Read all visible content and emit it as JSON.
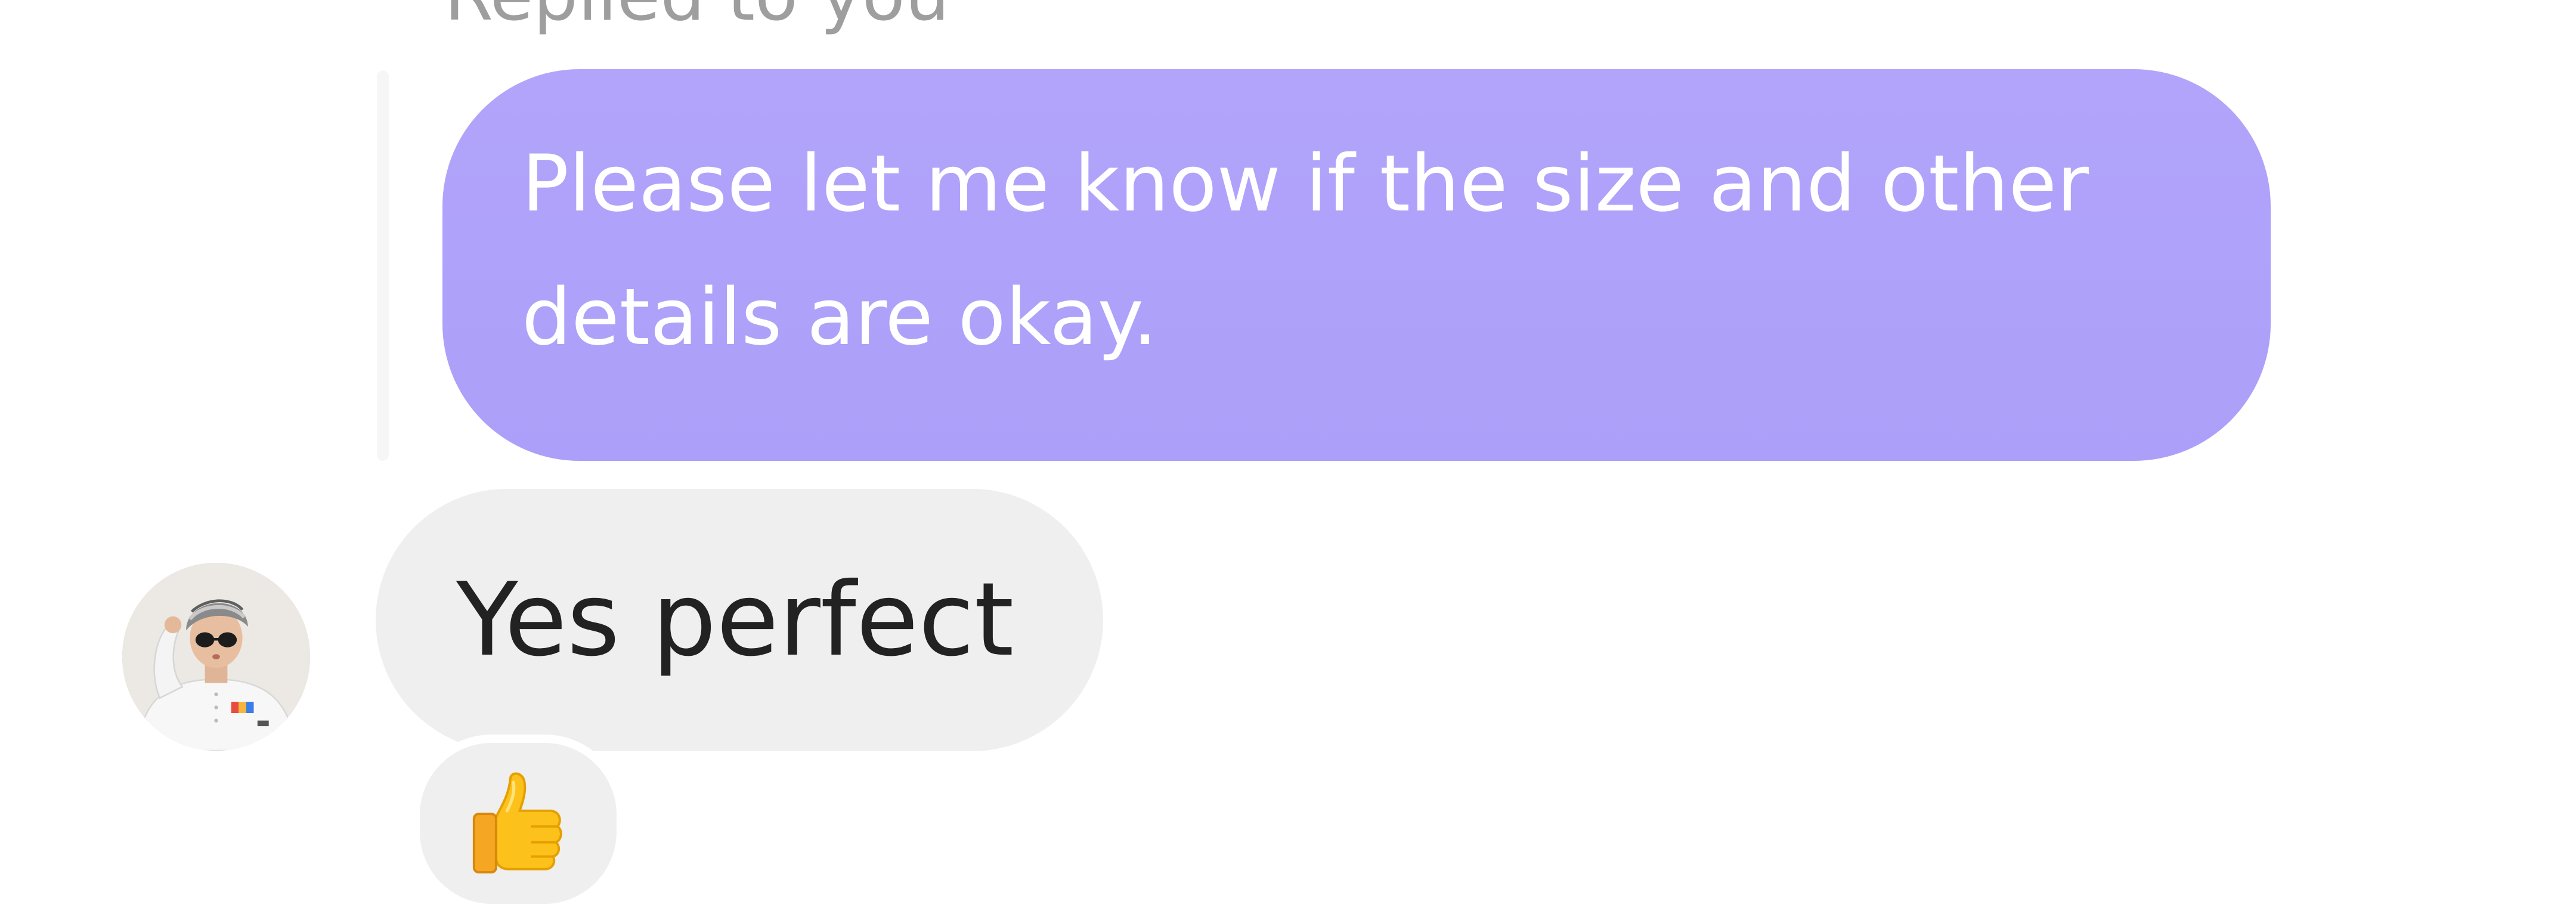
{
  "thread": {
    "reply_context": "Replied to you",
    "replied_message": {
      "text": "Please let me know if the size and other details are okay.",
      "bubble_color": "#b0a3fa",
      "text_color": "#ffffff"
    },
    "incoming_message": {
      "text": "Yes perfect",
      "bubble_color": "#efefef",
      "text_color": "#222222"
    },
    "reaction": {
      "icon": "thumbs-up-icon"
    },
    "sender_avatar": {
      "icon": "user-avatar"
    }
  }
}
